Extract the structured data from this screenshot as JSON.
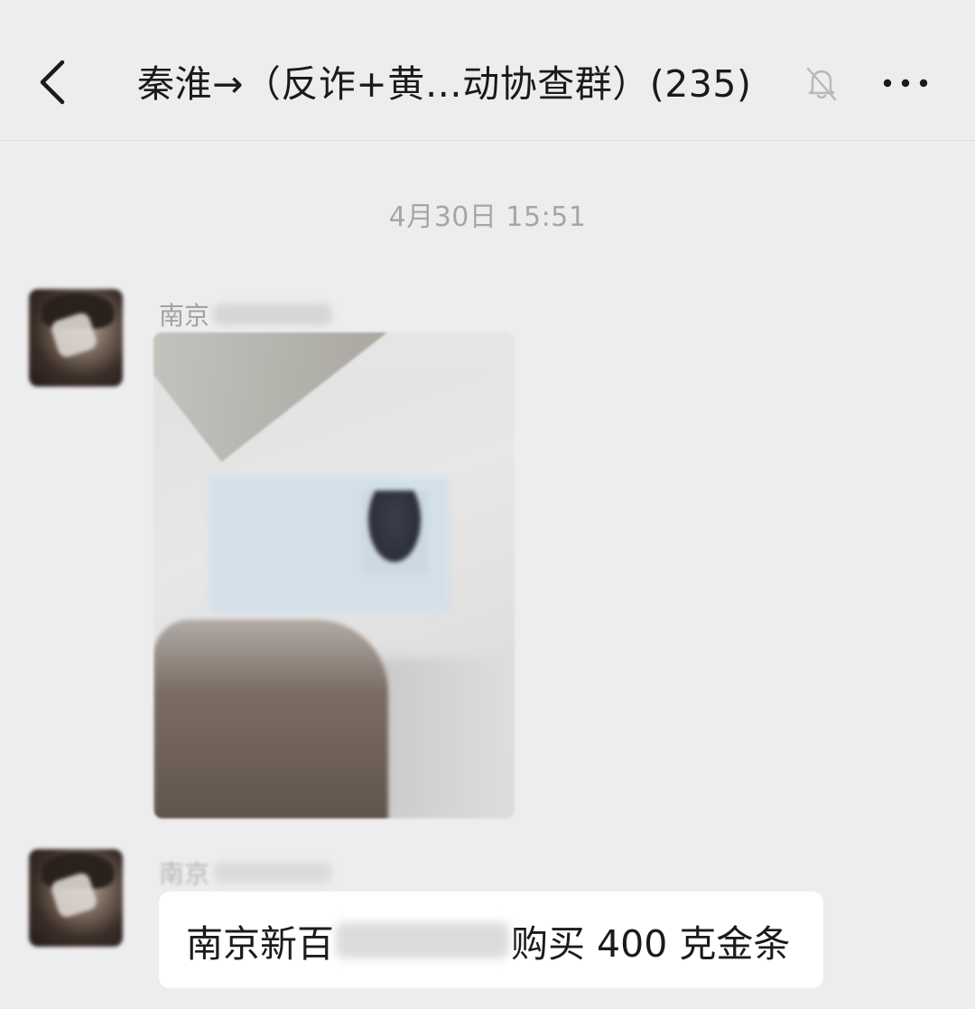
{
  "header": {
    "back_icon": "chevron-left-icon",
    "title": "秦淮→（反诈+黄…动协查群）(235)",
    "mute_icon": "bell-off-icon",
    "more_icon": "more-dots-icon"
  },
  "chat": {
    "timestamp": "4月30日 15:51",
    "messages": [
      {
        "sender_visible": "南京",
        "type": "image",
        "image_icon": "blurred-id-card-photo"
      },
      {
        "sender_visible": "南京",
        "type": "text",
        "text_before": "南京新百",
        "text_after": "购买 400 克金条"
      }
    ]
  },
  "colors": {
    "background": "#ededed",
    "bubble": "#ffffff",
    "timestamp": "#a6a6a6",
    "sender": "#a1a1a1"
  }
}
